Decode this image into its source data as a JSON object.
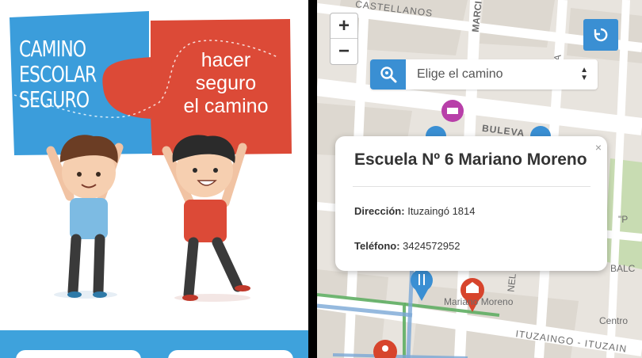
{
  "left_panel": {
    "blue_piece_text": "CAMINO ESCOLAR SEGURO",
    "red_piece_text": "hacer seguro el camino",
    "colors": {
      "blue_piece": "#3b9ddb",
      "red_piece": "#dc4a37",
      "band": "#3ea2dc"
    }
  },
  "map": {
    "zoom_in_label": "+",
    "zoom_out_label": "−",
    "reset_icon": "refresh-icon",
    "route_select": {
      "value": "Elige el camino",
      "icon": "search-location-icon"
    },
    "street_labels": {
      "castellanos": "CASTELLANOS",
      "marcial": "MARCI",
      "bulevar": "BULEVA",
      "balc": "BALC",
      "ituzaingo": "ITUZAINGO - ITUZAIN",
      "centro": "Centro",
      "nel": "NEL",
      "ea": "EA",
      "p": "\"P",
      "school_label": "Mariano Moreno"
    },
    "popup": {
      "title": "Escuela Nº 6 Mariano Moreno",
      "close": "×",
      "address_label": "Dirección:",
      "address_value": "Ituzaingó 1814",
      "phone_label": "Teléfono:",
      "phone_value": "3424572952"
    },
    "colors": {
      "accent": "#3a8fd3",
      "school_marker": "#d7442c",
      "shop_marker": "#b83fa9",
      "food_marker": "#3a8fd3",
      "route": "#5fae63"
    }
  }
}
